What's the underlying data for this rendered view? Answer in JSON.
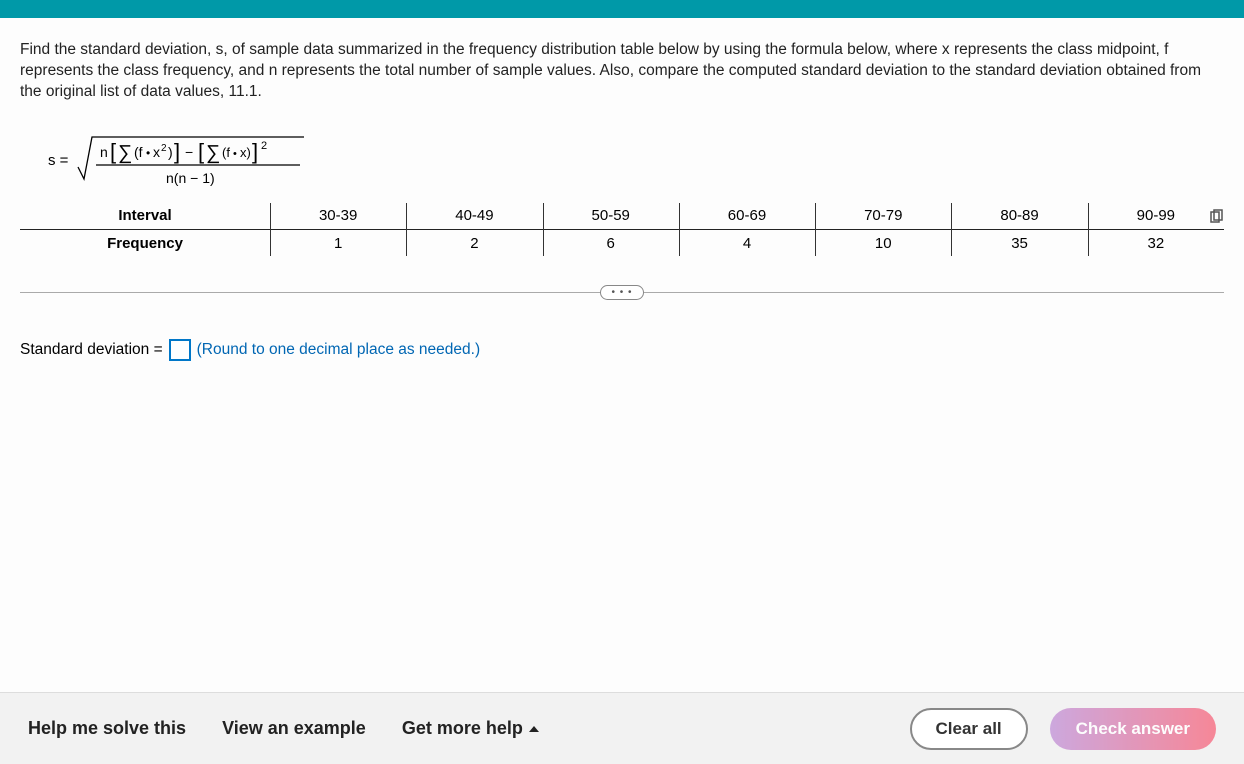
{
  "question": "Find the standard deviation, s, of sample data summarized in the frequency distribution table below by using the formula below, where x represents the class midpoint, f represents the class frequency, and n represents the total number of sample values. Also, compare the computed standard deviation to the standard deviation obtained from the original list of data values, 11.1.",
  "formula": {
    "lhs": "s =",
    "numerator": "n[∑(f•x²)] − [∑(f•x)]²",
    "denominator": "n(n − 1)"
  },
  "table": {
    "row1_label": "Interval",
    "row2_label": "Frequency",
    "intervals": [
      "30-39",
      "40-49",
      "50-59",
      "60-69",
      "70-79",
      "80-89",
      "90-99"
    ],
    "frequencies": [
      "1",
      "2",
      "6",
      "4",
      "10",
      "35",
      "32"
    ]
  },
  "answer": {
    "label": "Standard deviation =",
    "value": "",
    "hint": "(Round to one decimal place as needed.)"
  },
  "footer": {
    "help": "Help me solve this",
    "example": "View an example",
    "more": "Get more help",
    "clear": "Clear all",
    "check": "Check answer"
  },
  "ellipsis": "• • •"
}
